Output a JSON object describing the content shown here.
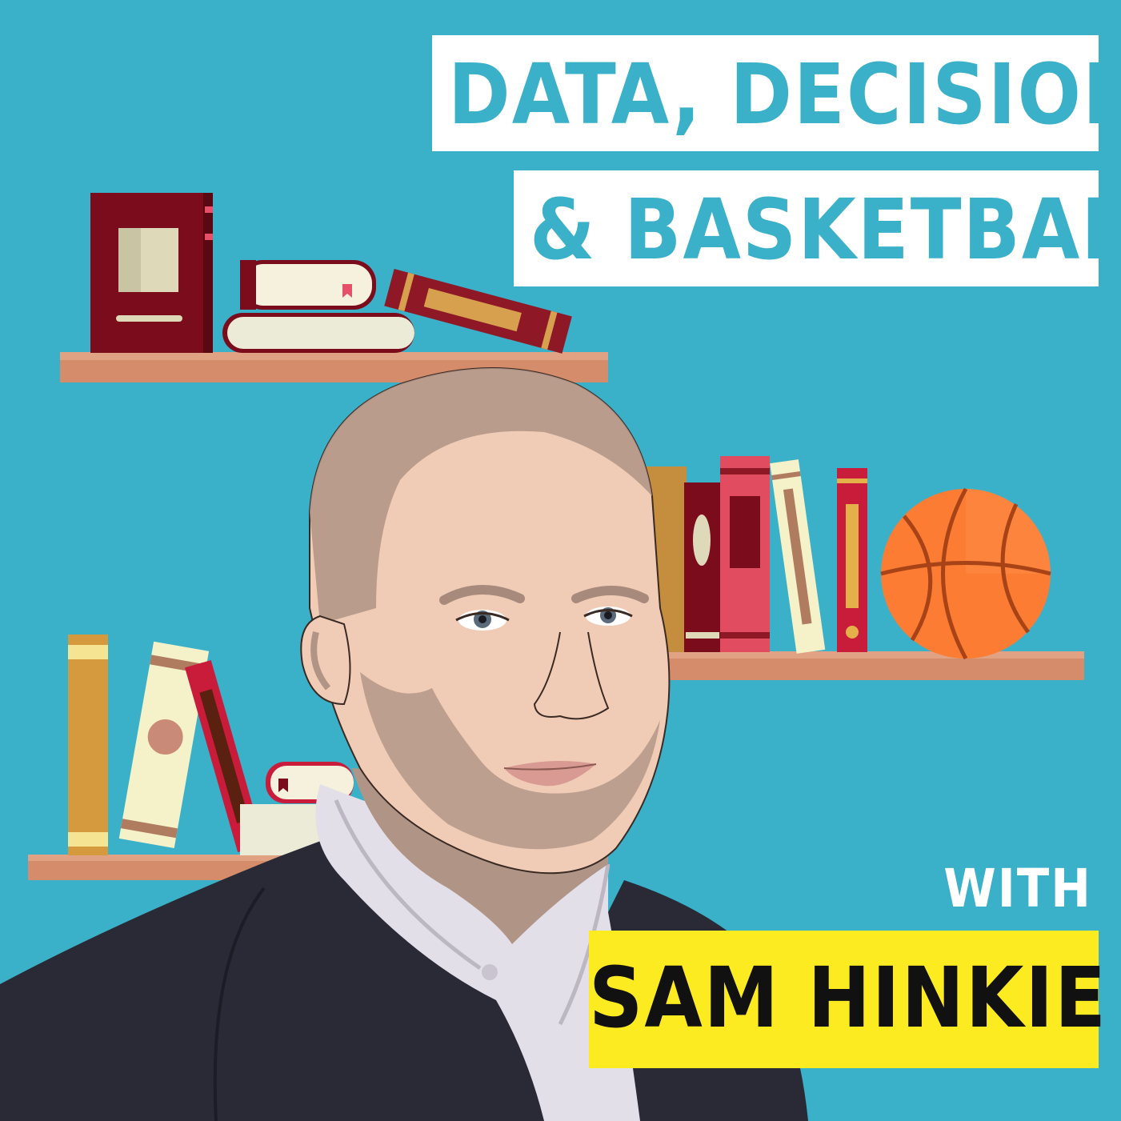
{
  "title": {
    "line1": "DATA, DECISIONS",
    "line2": "& BASKETBALL"
  },
  "guest": {
    "with_label": "WITH",
    "name": "SAM HINKIE"
  },
  "colors": {
    "background": "#3ab1c9",
    "title_box": "#ffffff",
    "title_text": "#3ab1c9",
    "name_box": "#fdeb22",
    "name_text": "#111111",
    "shelf": "#d48c6b"
  },
  "icons": [
    "bookshelf-illustration",
    "basketball-icon",
    "portrait-illustration"
  ]
}
